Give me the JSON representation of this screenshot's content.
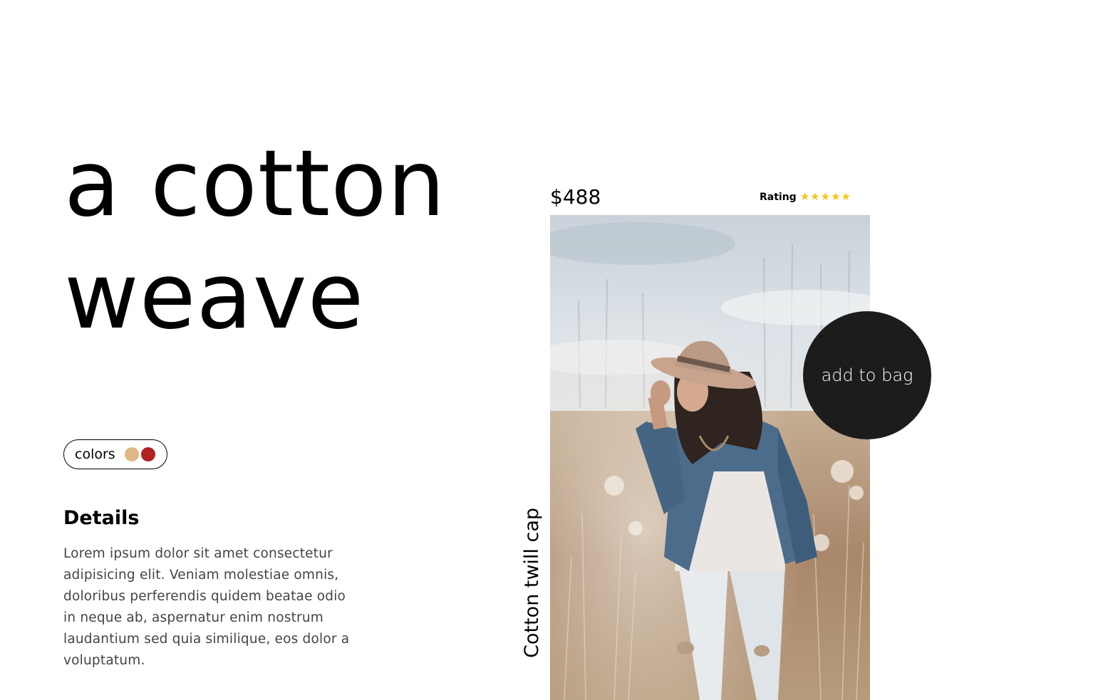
{
  "product": {
    "headline_line1": "a cotton",
    "headline_line2": "weave",
    "colors_label": "colors",
    "color_swatches": [
      "#deb887",
      "#b22222"
    ],
    "details_title": "Details",
    "details_text": "Lorem ipsum dolor sit amet consectetur adipisicing elit. Veniam molestiae omnis, doloribus perferendis quidem beatae odio in neque ab, aspernatur enim nostrum laudantium sed quia similique, eos dolor a voluptatum.",
    "price": "$488",
    "rating_label": "Rating",
    "rating_stars": 5,
    "star_color": "#f5c518",
    "name": "Cotton twill cap",
    "add_to_bag_label": "add to bag",
    "button_color": "#1c1c1c"
  }
}
